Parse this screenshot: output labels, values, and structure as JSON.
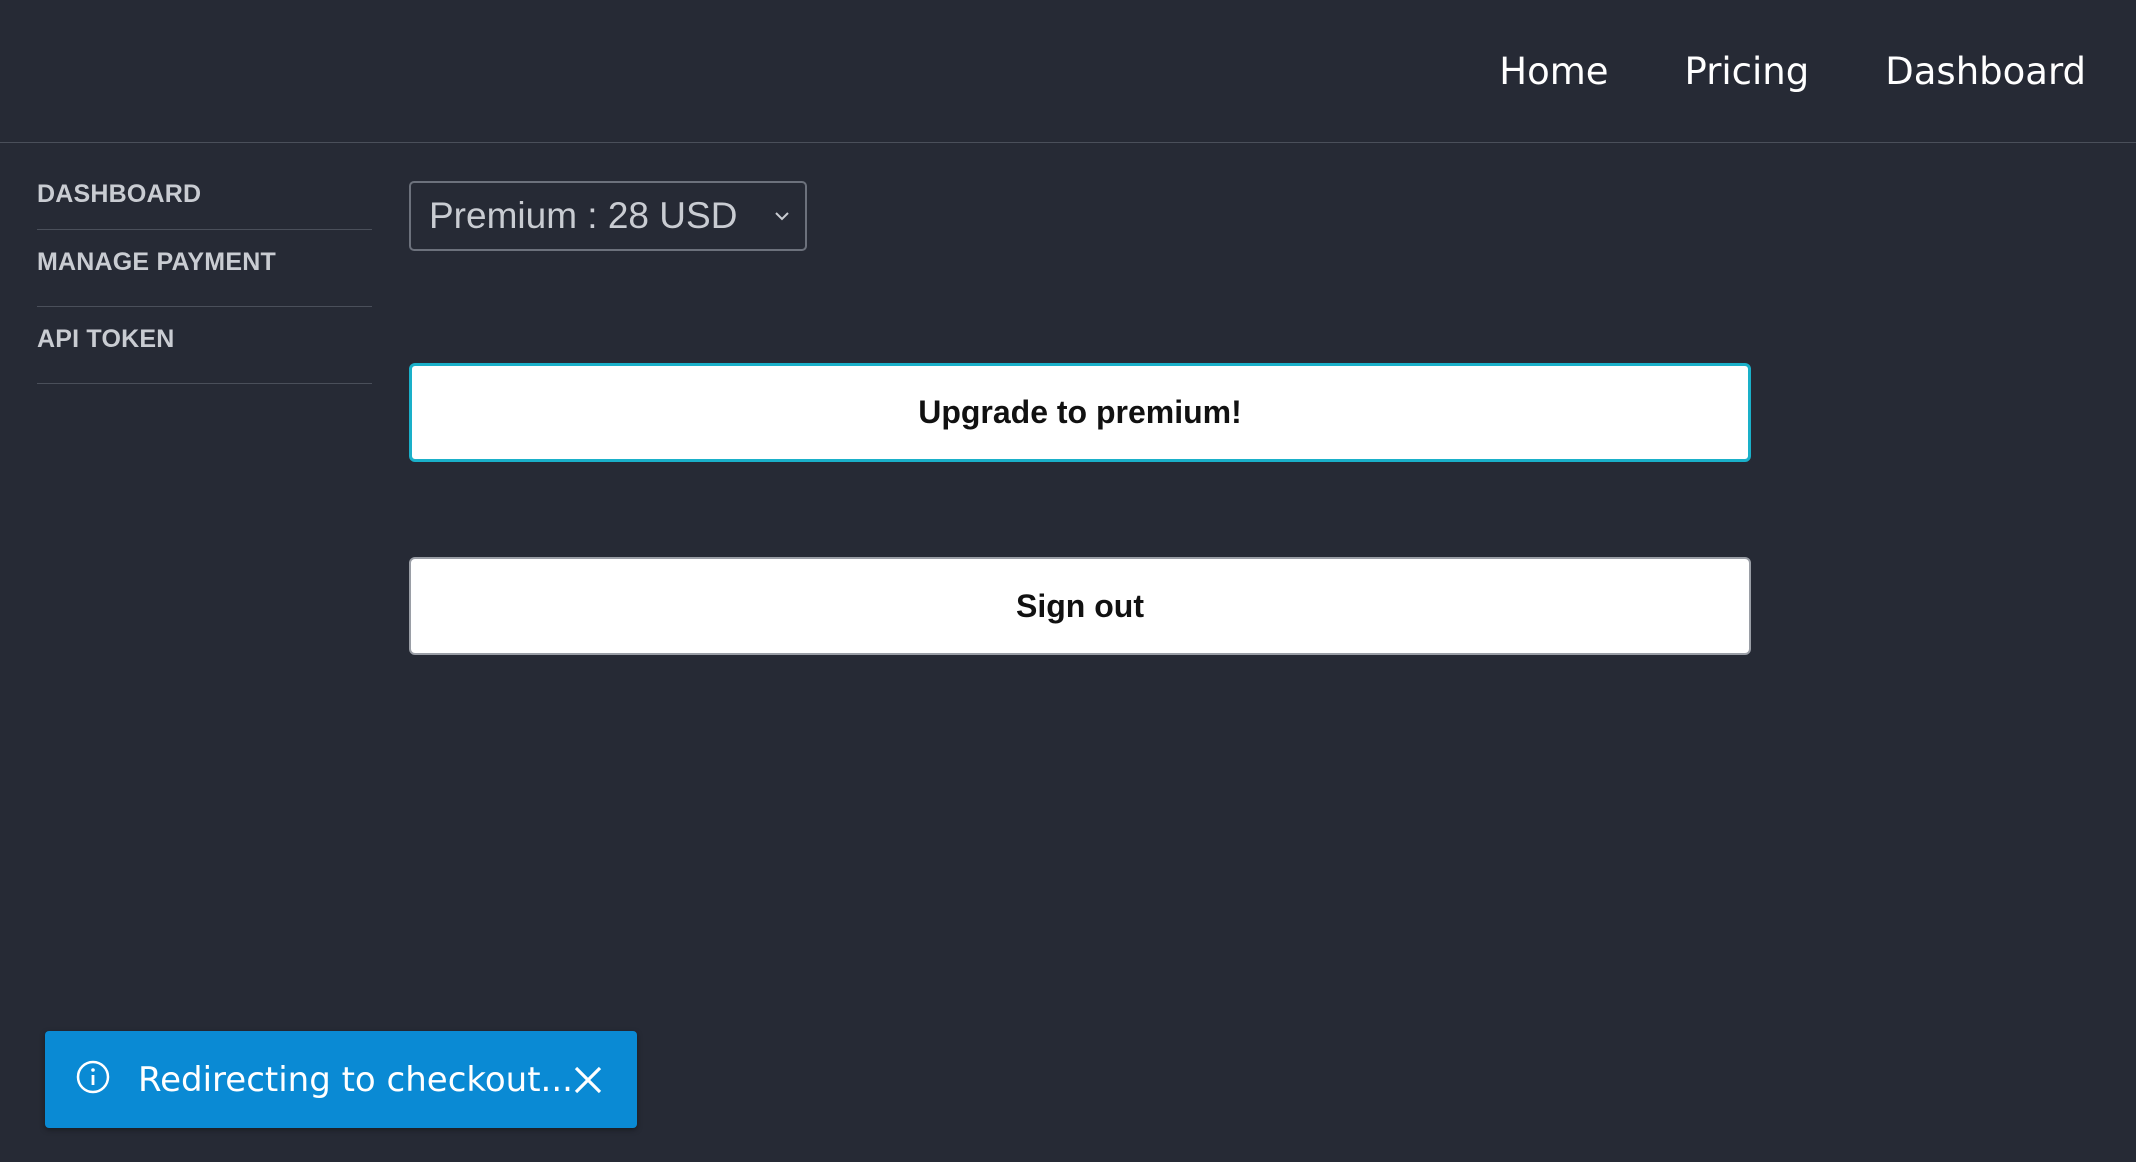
{
  "nav": {
    "items": [
      "Home",
      "Pricing",
      "Dashboard"
    ]
  },
  "sidebar": {
    "items": [
      {
        "label": "DASHBOARD"
      },
      {
        "label": "MANAGE PAYMENT"
      },
      {
        "label": "API TOKEN"
      }
    ]
  },
  "plan_select": {
    "selected": "Premium : 28 USD"
  },
  "buttons": {
    "upgrade_label": "Upgrade to premium!",
    "signout_label": "Sign out"
  },
  "toast": {
    "message": "Redirecting to checkout...",
    "icon": "info-icon",
    "close_icon": "close-icon",
    "color": "#0a8ad4"
  },
  "colors": {
    "background": "#262a35",
    "accent": "#1ab0c9"
  }
}
